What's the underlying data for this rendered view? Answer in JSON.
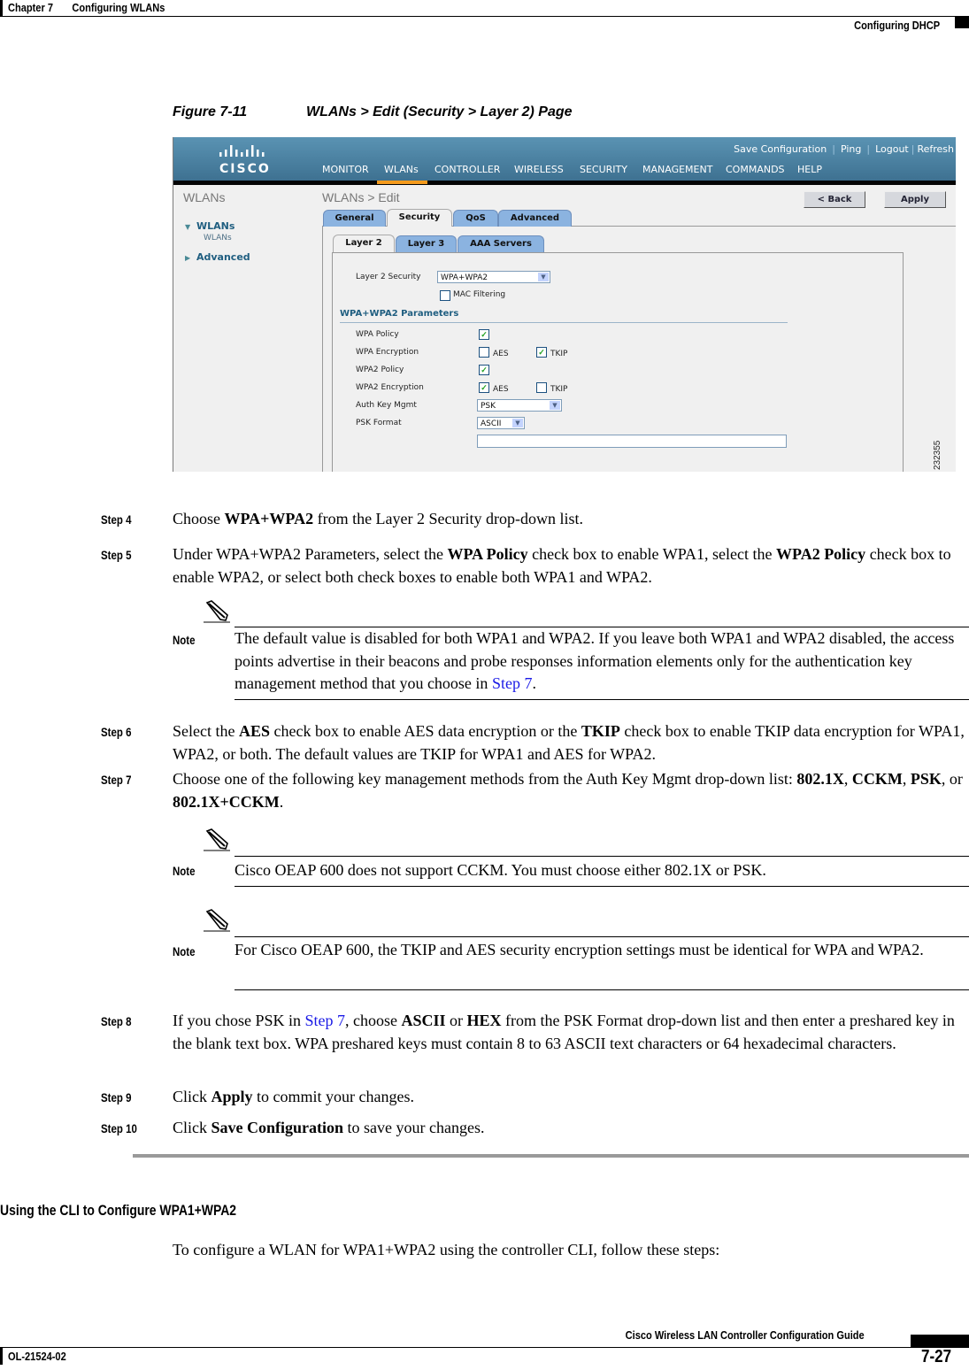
{
  "header": {
    "chapter": "Chapter 7",
    "chapter_title": "Configuring WLANs",
    "section": "Configuring DHCP"
  },
  "figure": {
    "number": "Figure 7-11",
    "title": "WLANs > Edit (Security > Layer 2) Page",
    "id": "232355"
  },
  "screenshot": {
    "brand": "CISCO",
    "top_links": [
      "Save Configuration",
      "Ping",
      "Logout",
      "Refresh"
    ],
    "nav": [
      "MONITOR",
      "WLANs",
      "CONTROLLER",
      "WIRELESS",
      "SECURITY",
      "MANAGEMENT",
      "COMMANDS",
      "HELP"
    ],
    "active_nav": "WLANs",
    "sidebar": {
      "title": "WLANs",
      "items": [
        {
          "label": "WLANs",
          "expanded": true,
          "children": [
            "WLANs"
          ]
        },
        {
          "label": "Advanced",
          "expanded": false
        }
      ]
    },
    "page_title": "WLANs > Edit",
    "buttons": {
      "back": "< Back",
      "apply": "Apply"
    },
    "tabs": [
      "General",
      "Security",
      "QoS",
      "Advanced"
    ],
    "active_tab": "Security",
    "subtabs": [
      "Layer 2",
      "Layer 3",
      "AAA Servers"
    ],
    "active_subtab": "Layer 2",
    "layer2_security_label": "Layer 2 Security",
    "layer2_security_value": "WPA+WPA2",
    "mac_filtering_label": "MAC Filtering",
    "mac_filtering_checked": false,
    "params_title": "WPA+WPA2 Parameters",
    "wpa_policy_label": "WPA Policy",
    "wpa_policy_checked": true,
    "wpa_encryption_label": "WPA Encryption",
    "wpa_aes_label": "AES",
    "wpa_aes_checked": false,
    "wpa_tkip_label": "TKIP",
    "wpa_tkip_checked": true,
    "wpa2_policy_label": "WPA2 Policy",
    "wpa2_policy_checked": true,
    "wpa2_encryption_label": "WPA2 Encryption",
    "wpa2_aes_label": "AES",
    "wpa2_aes_checked": true,
    "wpa2_tkip_label": "TKIP",
    "wpa2_tkip_checked": false,
    "auth_key_label": "Auth Key Mgmt",
    "auth_key_value": "PSK",
    "psk_format_label": "PSK Format",
    "psk_format_value": "ASCII",
    "psk_key_value": ""
  },
  "steps": [
    {
      "label": "Step 4"
    },
    {
      "label": "Step 5"
    },
    {
      "label": "Step 6"
    },
    {
      "label": "Step 7"
    },
    {
      "label": "Step 8"
    },
    {
      "label": "Step 9"
    },
    {
      "label": "Step 10"
    }
  ],
  "text": {
    "s4_a": "Choose ",
    "s4_b": "WPA+WPA2",
    "s4_c": " from the Layer 2 Security drop-down list.",
    "s5_a": "Under WPA+WPA2 Parameters, select the ",
    "s5_b": "WPA Policy",
    "s5_c": " check box to enable WPA1, select the ",
    "s5_d": "WPA2 Policy",
    "s5_e": " check box to enable WPA2, or select both check boxes to enable both WPA1 and WPA2.",
    "note_label": "Note",
    "n1_a": "The default value is disabled for both WPA1 and WPA2. If you leave both WPA1 and WPA2 disabled, the access points advertise in their beacons and probe responses information elements only for the authentication key management method that you choose in ",
    "n1_link": "Step 7",
    "n1_b": ".",
    "s6_a": "Select the ",
    "s6_b": "AES",
    "s6_c": " check box to enable AES data encryption or the ",
    "s6_d": "TKIP",
    "s6_e": " check box to enable TKIP data encryption for WPA1, WPA2, or both. The default values are TKIP for WPA1 and AES for WPA2.",
    "s7_a": "Choose one of the following key management methods from the Auth Key Mgmt drop-down list: ",
    "s7_b": "802.1X",
    "s7_c": ", ",
    "s7_d": "CCKM",
    "s7_e": ", ",
    "s7_f": "PSK",
    "s7_g": ", or ",
    "s7_h": "802.1X+CCKM",
    "s7_i": ".",
    "n2": "Cisco OEAP 600 does not support CCKM. You must choose either 802.1X or PSK.",
    "n3": "For Cisco OEAP 600, the TKIP and AES security encryption settings must be identical for WPA and WPA2.",
    "s8_a": "If you chose PSK in ",
    "s8_link": "Step 7",
    "s8_b": ", choose ",
    "s8_c": "ASCII",
    "s8_d": " or ",
    "s8_e": "HEX",
    "s8_f": " from the PSK Format drop-down list and then enter a preshared key in the blank text box. WPA preshared keys must contain 8 to 63 ASCII text characters or 64 hexadecimal characters.",
    "s9_a": "Click ",
    "s9_b": "Apply",
    "s9_c": " to commit your changes.",
    "s10_a": "Click ",
    "s10_b": "Save Configuration",
    "s10_c": " to save your changes.",
    "section_title": "Using the CLI to Configure WPA1+WPA2",
    "section_intro": "To configure a WLAN for WPA1+WPA2 using the controller CLI, follow these steps:"
  },
  "footer": {
    "guide_title": "Cisco Wireless LAN Controller Configuration Guide",
    "doc_number": "OL-21524-02",
    "page_number": "7-27"
  }
}
